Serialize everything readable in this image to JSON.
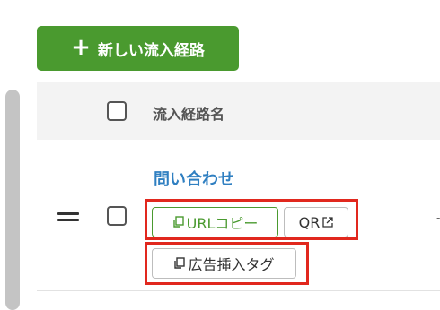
{
  "toolbar": {
    "add_route_label": "新しい流入経路"
  },
  "table": {
    "header": {
      "name_column": "流入経路名"
    },
    "rows": [
      {
        "name": "問い合わせ",
        "url_copy_label": "URLコピー",
        "qr_label": "QR",
        "ad_tag_label": "広告挿入タグ"
      }
    ]
  },
  "colors": {
    "primary_green": "#4a9a2f",
    "link_blue": "#2f7fc1",
    "highlight_red": "#e1281e"
  },
  "icons": [
    "plus-icon",
    "drag-handle-icon",
    "copy-icon",
    "external-link-icon"
  ]
}
